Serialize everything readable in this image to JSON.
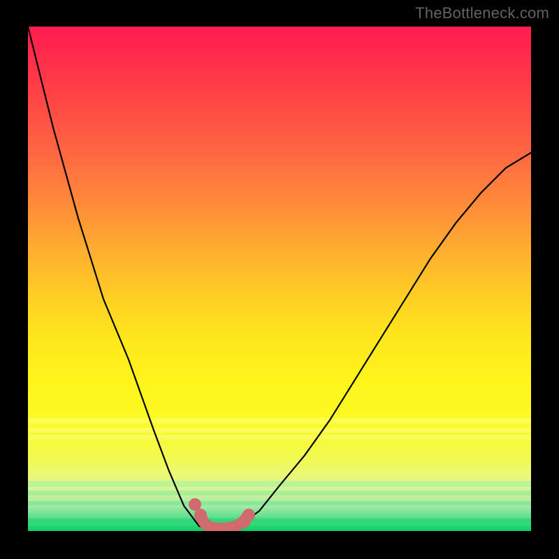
{
  "watermark": "TheBottleneck.com",
  "chart_data": {
    "type": "line",
    "title": "",
    "xlabel": "",
    "ylabel": "",
    "x": [
      0.0,
      0.05,
      0.1,
      0.15,
      0.2,
      0.25,
      0.28,
      0.31,
      0.34,
      0.37,
      0.39,
      0.42,
      0.46,
      0.5,
      0.55,
      0.6,
      0.65,
      0.7,
      0.75,
      0.8,
      0.85,
      0.9,
      0.95,
      1.0
    ],
    "values": [
      1.0,
      0.8,
      0.62,
      0.46,
      0.34,
      0.2,
      0.12,
      0.05,
      0.01,
      0.0,
      0.0,
      0.01,
      0.04,
      0.09,
      0.15,
      0.22,
      0.3,
      0.38,
      0.46,
      0.54,
      0.61,
      0.67,
      0.72,
      0.75
    ],
    "ylim": [
      0,
      1
    ],
    "xlim": [
      0,
      1
    ],
    "minimum_x": 0.38,
    "background_gradient": [
      "#ff1c4f",
      "#ffd322",
      "#fff41a",
      "#13c765"
    ],
    "highlight_range_x": [
      0.33,
      0.44
    ],
    "notes": "Axes and tick labels are not displayed in the original image; x and y are normalized."
  }
}
